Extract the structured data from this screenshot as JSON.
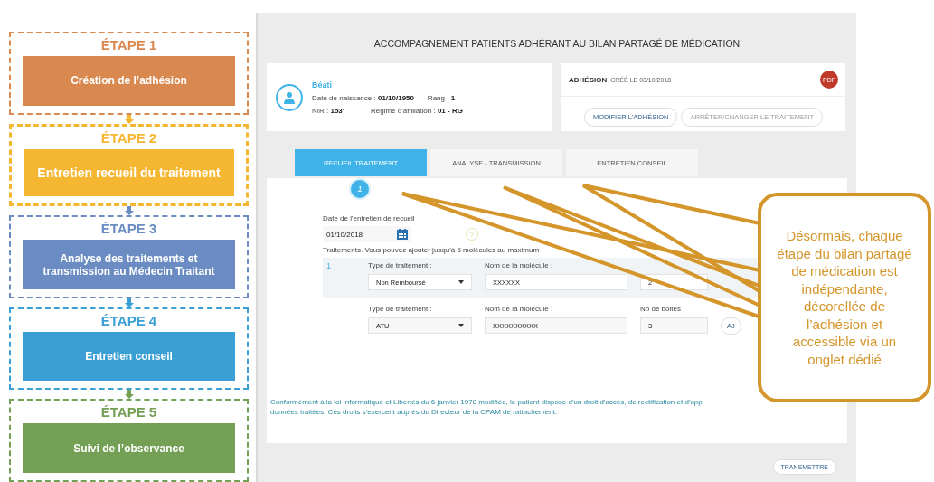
{
  "steps": [
    {
      "label": "ÉTAPE 1",
      "title": "Création de l’adhésion",
      "color": "#d9884f",
      "selected": false
    },
    {
      "label": "ÉTAPE 2",
      "title": "Entretien recueil du traitement",
      "color": "#f5b731",
      "selected": true
    },
    {
      "label": "ÉTAPE 3",
      "title": "Analyse des traitements et transmission au Médecin Traitant",
      "color": "#6a8cc2",
      "selected": false
    },
    {
      "label": "ÉTAPE 4",
      "title": "Entretien conseil",
      "color": "#3a9fd4",
      "selected": false
    },
    {
      "label": "ÉTAPE 5",
      "title": "Suivi de l’observance",
      "color": "#73a055",
      "selected": false
    }
  ],
  "screen": {
    "title": "ACCOMPAGNEMENT PATIENTS ADHÉRANT AU BILAN PARTAGÉ DE MÉDICATION",
    "patient": {
      "name": "Béati",
      "lines": [
        [
          {
            "label": "Date de naissance :",
            "value": "01/10/1950"
          },
          {
            "label": "- Rang :",
            "value": "1"
          }
        ],
        [
          {
            "label": "NIR :",
            "value": "153'"
          },
          {
            "label": "Régime d'affiliation :",
            "value": "01 - RG"
          }
        ]
      ]
    },
    "adhesion": {
      "title": "ADHÉSION",
      "created": "CRÉÉ LE 03/10/2018",
      "pdf": "PDF",
      "buttons": [
        {
          "label": "MODIFIER L'ADHÉSION",
          "disabled": false
        },
        {
          "label": "ARRÊTER/CHANGER LE TRAITEMENT",
          "disabled": true
        }
      ]
    },
    "tabs": [
      {
        "label": "RECUEIL TRAITEMENT",
        "selected": true
      },
      {
        "label": "ANALYSE - TRANSMISSION",
        "selected": false
      },
      {
        "label": "ENTRETIEN CONSEIL",
        "selected": false
      }
    ],
    "step_number": "1",
    "date_label": "Date de l'entretien de recueil",
    "date_value": "01/10/2018",
    "help": "?",
    "treatments_label": "Traitements. Vous pouvez ajouter jusqu'à 5 molécules au maximum :",
    "treatments": [
      {
        "index": "1",
        "selected": true,
        "type_label": "Type de traitement :",
        "type": "Non Remboursé",
        "molecule_label": "Nom de la molécule :",
        "molecule": "XXXXXX",
        "boxes": "2"
      },
      {
        "selected": false,
        "type_label": "Type de traitement :",
        "type": "ATU",
        "molecule_label": "Nom de la molécule :",
        "molecule": "XXXXXXXXXX",
        "boxes_label": "Nb de boites :",
        "boxes": "3",
        "action": "AJ"
      }
    ],
    "legal": [
      "Conformément à la loi Informatique et Libertés du 6 janvier 1978 modifiée, le patient dispose d'un droit d'accès, de rectification et d'opp",
      "données traitées. Ces droits s'exercent auprès du Directeur de la CPAM de rattachement."
    ],
    "submit": "TRANSMETTRE"
  },
  "callout": {
    "text": "Désormais, chaque étape du bilan partagé de médication est indépendante, décorellée de l’adhésion et accessible via un onglet dédié"
  }
}
